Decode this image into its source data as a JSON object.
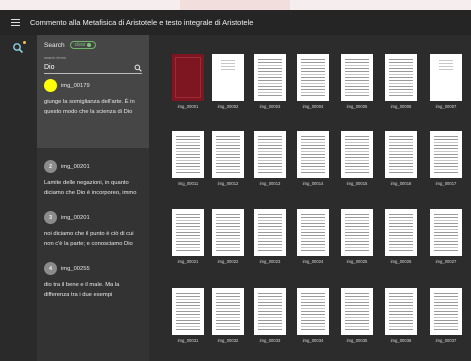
{
  "app": {
    "title": "Commento alla Metafisica di Aristotele e testo integrale di Aristotele"
  },
  "panel": {
    "title": "Search",
    "chip_label": "clear",
    "search_label": "search terms",
    "search_value": "Dio"
  },
  "results": [
    {
      "badge": "",
      "active": true,
      "name": "img_00179",
      "text": "giunge la somiglianza dell'arte. È in questo modo che la scienza di Dio"
    },
    {
      "badge": "2",
      "active": false,
      "name": "img_00201",
      "text": "Lamite delle negazioni, in quanto diciamo che Dio è incorporeo, immo"
    },
    {
      "badge": "3",
      "active": false,
      "name": "img_00201",
      "text": "noi diciamo che il punto è ciò di cui non c'è la parte; e conosciamo Dio"
    },
    {
      "badge": "4",
      "active": false,
      "name": "img_00255",
      "text": "dio tra il bene e il male. Ma la differenza tra i due esempi"
    }
  ],
  "thumbnails": [
    [
      "img_00001",
      "img_00002",
      "img_00003",
      "img_00004",
      "img_00005",
      "img_00006",
      "img_00007"
    ],
    [
      "img_00011",
      "img_00012",
      "img_00013",
      "img_00014",
      "img_00015",
      "img_00016",
      "img_00017"
    ],
    [
      "img_00021",
      "img_00022",
      "img_00023",
      "img_00024",
      "img_00025",
      "img_00026",
      "img_00027"
    ],
    [
      "img_00031",
      "img_00032",
      "img_00033",
      "img_00034",
      "img_00035",
      "img_00036",
      "img_00037"
    ]
  ],
  "colors": {
    "accent": "#ffff0a",
    "chip": "#71b46a",
    "panel_head": "#464646",
    "background": "#2c2c2c"
  },
  "icons": {
    "menu": "hamburger-icon",
    "search": "search-icon"
  }
}
